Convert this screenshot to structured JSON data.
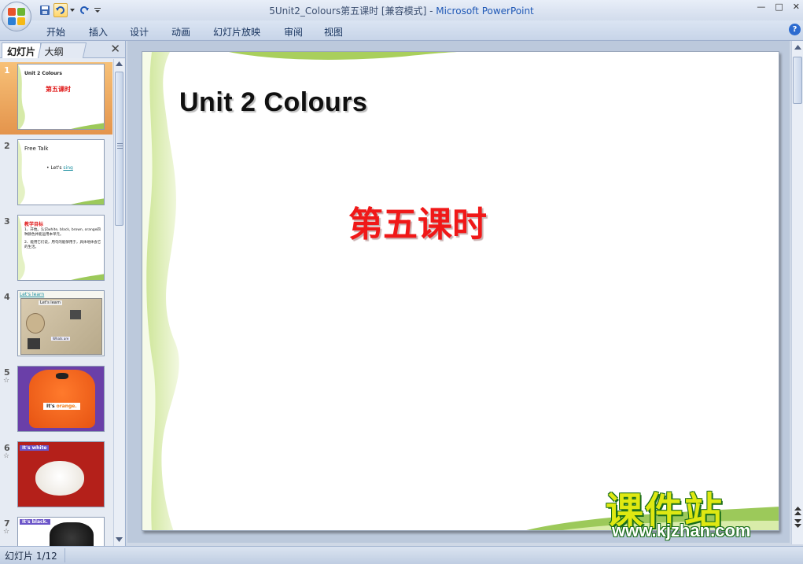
{
  "window": {
    "title_doc": "5Unit2_Colours第五课时 [兼容模式]",
    "title_sep": " - ",
    "title_app": "Microsoft PowerPoint",
    "minimize": "—",
    "restore": "□",
    "close": "✕"
  },
  "ribbon": {
    "tabs": [
      "开始",
      "插入",
      "设计",
      "动画",
      "幻灯片放映",
      "审阅",
      "视图"
    ],
    "help": "?"
  },
  "panel": {
    "tab_slides": "幻灯片",
    "tab_outline": "大纲",
    "close": "✕"
  },
  "thumbnails": [
    {
      "num": "1",
      "title": "Unit 2 Colours",
      "sub": "第五课时"
    },
    {
      "num": "2",
      "title": "Free Talk",
      "line": "• Let's ",
      "link": "sing"
    },
    {
      "num": "3",
      "title": "教学目标",
      "line1": "1、开始。认识white, black, brown, orange四种颜色并能运用本单元。",
      "line2": "2、能用它们说，用句的能够用于，具体地体会它的生活。"
    },
    {
      "num": "4",
      "title": "Let's learn",
      "inner": "Let's learn",
      "note": "Whats are"
    },
    {
      "num": "5",
      "star": "☆",
      "caption": "It's ",
      "color_word": "orange."
    },
    {
      "num": "6",
      "star": "☆",
      "caption": "It's ",
      "color_word": "white"
    },
    {
      "num": "7",
      "star": "☆",
      "caption": "It's ",
      "color_word": "black."
    }
  ],
  "slide": {
    "title": "Unit 2  Colours",
    "subtitle": "第五课时"
  },
  "watermark": {
    "cn": "课件站",
    "url": "www.kjzhan.com"
  },
  "status": {
    "slide_label": "幻灯片 1/12"
  },
  "colors": {
    "accent_red": "#f01818",
    "selected_thumb": "#e4944c",
    "leaf_green": "#c8e28a"
  }
}
